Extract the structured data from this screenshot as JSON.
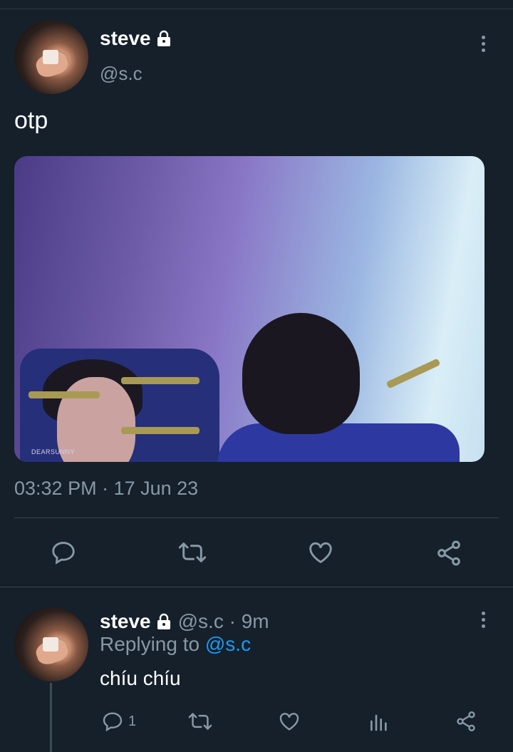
{
  "tweet": {
    "name": "steve",
    "handle": "@s.c",
    "text": "otp",
    "image": {
      "watermark": "DEARSUNNY"
    },
    "timestamp": "03:32 PM · 17 Jun 23",
    "locked": true
  },
  "actions": {
    "icons": [
      "reply-icon",
      "retweet-icon",
      "like-icon",
      "share-icon"
    ]
  },
  "reply": {
    "name": "steve",
    "meta": "@s.c · 9m",
    "replying_prefix": "Replying to",
    "replying_handle": "@s.c",
    "text": "chíu chíu",
    "reply_count": "1",
    "icons": [
      "reply-icon",
      "retweet-icon",
      "like-icon",
      "analytics-icon",
      "share-icon"
    ]
  },
  "colors": {
    "background": "#15202b",
    "muted": "#8899a6",
    "link": "#1d9bf0",
    "divider": "#38444d"
  }
}
